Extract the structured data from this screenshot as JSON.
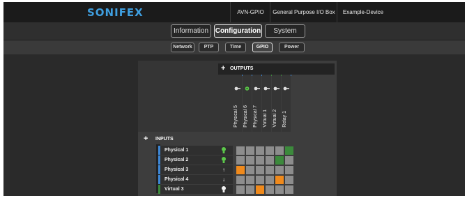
{
  "header": {
    "logo": "SONIFEX",
    "device_model": "AVN-GPIO",
    "device_description": "General Purpose I/O Box",
    "device_name": "Example-Device"
  },
  "main_tabs": [
    {
      "label": "Information",
      "active": false
    },
    {
      "label": "Configuration",
      "active": true
    },
    {
      "label": "System",
      "active": false
    }
  ],
  "sub_tabs": [
    {
      "label": "Network",
      "active": false
    },
    {
      "label": "PTP",
      "active": false
    },
    {
      "label": "Time",
      "active": false
    },
    {
      "label": "GPIO",
      "active": true
    },
    {
      "label": "Power",
      "active": false
    }
  ],
  "gpio": {
    "outputs_title": "OUTPUTS",
    "inputs_title": "INPUTS",
    "outputs": [
      {
        "label": "Physical 5",
        "type": "physical",
        "state_icon": "output-off-icon"
      },
      {
        "label": "Physical 6",
        "type": "physical",
        "state_icon": "output-on-icon"
      },
      {
        "label": "Physical 7",
        "type": "physical",
        "state_icon": "output-off-icon"
      },
      {
        "label": "Virtual 1",
        "type": "virtual",
        "state_icon": "output-off-icon"
      },
      {
        "label": "Virtual 2",
        "type": "virtual",
        "state_icon": "output-off-icon"
      },
      {
        "label": "Relay 1",
        "type": "physical",
        "state_icon": "output-off-icon"
      }
    ],
    "inputs": [
      {
        "label": "Physical 1",
        "type": "physical",
        "state_icon": "bulb-green-icon",
        "icon_glyph": ""
      },
      {
        "label": "Physical 2",
        "type": "physical",
        "state_icon": "bulb-green-icon",
        "icon_glyph": ""
      },
      {
        "label": "Physical 3",
        "type": "physical",
        "state_icon": "arrow-up-icon",
        "icon_glyph": "↑"
      },
      {
        "label": "Physical 4",
        "type": "physical",
        "state_icon": "arrow-down-icon",
        "icon_glyph": "↓"
      },
      {
        "label": "Virtual 3",
        "type": "virtual",
        "state_icon": "bulb-white-icon",
        "icon_glyph": ""
      }
    ],
    "matrix": [
      [
        "",
        "",
        "",
        "",
        "",
        "green"
      ],
      [
        "",
        "",
        "",
        "",
        "green",
        ""
      ],
      [
        "orange",
        "",
        "",
        "",
        "",
        ""
      ],
      [
        "",
        "",
        "",
        "",
        "orange",
        ""
      ],
      [
        "",
        "",
        "orange",
        "",
        "",
        ""
      ]
    ]
  },
  "colors": {
    "brand": "#3f9fe0",
    "physical": "#3d87d6",
    "virtual": "#3c8a3c",
    "active_green": "#3c8a3c",
    "active_orange": "#f08a1c",
    "inactive_cell": "#8d8d8d"
  }
}
